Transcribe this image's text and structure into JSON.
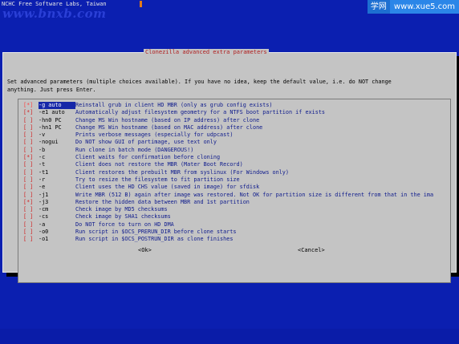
{
  "top": {
    "header_text": "NCHC Free Software Labs, Taiwan",
    "watermark": "www.bnxb.com",
    "xue5_left": "学网",
    "xue5_right": "www.xue5.com"
  },
  "dialog": {
    "title": "Clonezilla advanced extra parameters",
    "description": "Set advanced parameters (multiple choices available). If you have no idea, keep the default value, i.e. do NOT change\nanything. Just press Enter.",
    "options": [
      {
        "checkbox": "[*]",
        "key": "-g auto",
        "desc": "Reinstall grub in client HD MBR (only as grub config exists)"
      },
      {
        "checkbox": "[*]",
        "key": "-e1 auto",
        "desc": "Automatically adjust filesystem geometry for a NTFS boot partition if exists"
      },
      {
        "checkbox": "[ ]",
        "key": "-hn0 PC",
        "desc": "Change MS Win hostname (based on IP address) after clone"
      },
      {
        "checkbox": "[ ]",
        "key": "-hn1 PC",
        "desc": "Change MS Win hostname (based on MAC address) after clone"
      },
      {
        "checkbox": "[ ]",
        "key": "-v",
        "desc": "Prints verbose messages (especially for udpcast)"
      },
      {
        "checkbox": "[ ]",
        "key": "-nogui",
        "desc": "Do NOT show GUI of partimage, use text only"
      },
      {
        "checkbox": "[ ]",
        "key": "-b",
        "desc": "Run clone in batch mode (DANGEROUS!)"
      },
      {
        "checkbox": "[*]",
        "key": "-c",
        "desc": "Client waits for confirmation before cloning"
      },
      {
        "checkbox": "[ ]",
        "key": "-t",
        "desc": "Client does not restore the MBR (Mater Boot Record)"
      },
      {
        "checkbox": "[ ]",
        "key": "-t1",
        "desc": "Client restores the prebuilt MBR from syslinux (For Windows only)"
      },
      {
        "checkbox": "[ ]",
        "key": "-r",
        "desc": "Try to resize the filesystem to fit partition size"
      },
      {
        "checkbox": "[ ]",
        "key": "-e",
        "desc": "Client uses the HD CHS value (saved in image) for sfdisk"
      },
      {
        "checkbox": "[ ]",
        "key": "-j1",
        "desc": "Write MBR (512 B) again after image was restored. Not OK for partition size is different from that in the ima"
      },
      {
        "checkbox": "[*]",
        "key": "-j3",
        "desc": "Restore the hidden data between MBR and 1st partition"
      },
      {
        "checkbox": "[ ]",
        "key": "-cm",
        "desc": "Check image by MD5 checksums"
      },
      {
        "checkbox": "[ ]",
        "key": "-cs",
        "desc": "Check image by SHA1 checksums"
      },
      {
        "checkbox": "[ ]",
        "key": "-a",
        "desc": "Do NOT force to turn on HD DMA"
      },
      {
        "checkbox": "[ ]",
        "key": "-o0",
        "desc": "Run script in $OCS_PRERUN_DIR before clone starts"
      },
      {
        "checkbox": "[ ]",
        "key": "-o1",
        "desc": "Run script in $OCS_POSTRUN_DIR as clone finishes"
      }
    ],
    "ok_label": "<Ok>",
    "cancel_label": "<Cancel>"
  },
  "colors": {
    "background": "#0b1fb0",
    "dialog": "#c4c4c4",
    "title": "#b02020",
    "item_text": "#0d1a8c",
    "checkmark": "#d21e1e"
  }
}
